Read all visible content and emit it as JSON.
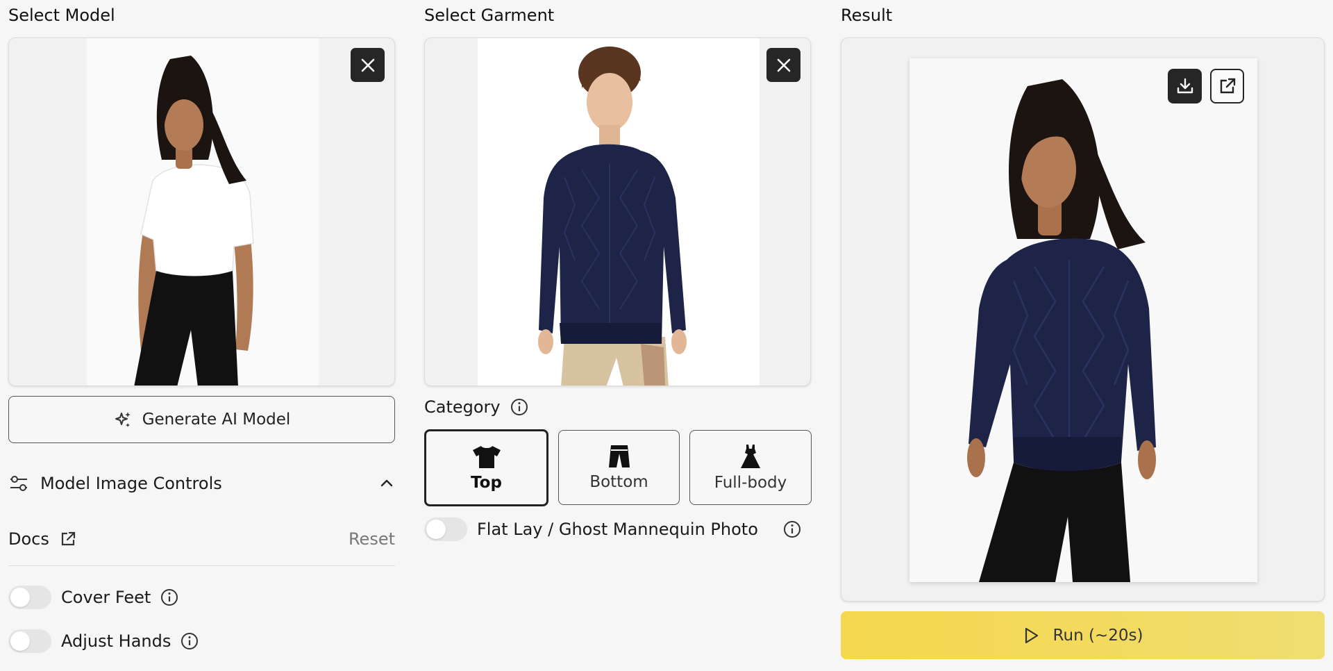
{
  "model_panel": {
    "title": "Select Model",
    "generate_label": "Generate AI Model",
    "controls_label": "Model Image Controls",
    "docs_label": "Docs",
    "reset_label": "Reset",
    "options": [
      {
        "label": "Cover Feet",
        "enabled": false
      },
      {
        "label": "Adjust Hands",
        "enabled": false
      }
    ]
  },
  "garment_panel": {
    "title": "Select Garment",
    "category_label": "Category",
    "categories": [
      {
        "label": "Top",
        "selected": true,
        "icon": "tshirt-icon"
      },
      {
        "label": "Bottom",
        "selected": false,
        "icon": "pants-icon"
      },
      {
        "label": "Full-body",
        "selected": false,
        "icon": "dress-icon"
      }
    ],
    "flatlay_label": "Flat Lay / Ghost Mannequin Photo",
    "flatlay_enabled": false
  },
  "result_panel": {
    "title": "Result",
    "run_label": "Run (~20s)"
  },
  "colors": {
    "accent_yellow": "#f5d84f",
    "dark": "#262626",
    "sweater_navy": "#1e2348"
  }
}
